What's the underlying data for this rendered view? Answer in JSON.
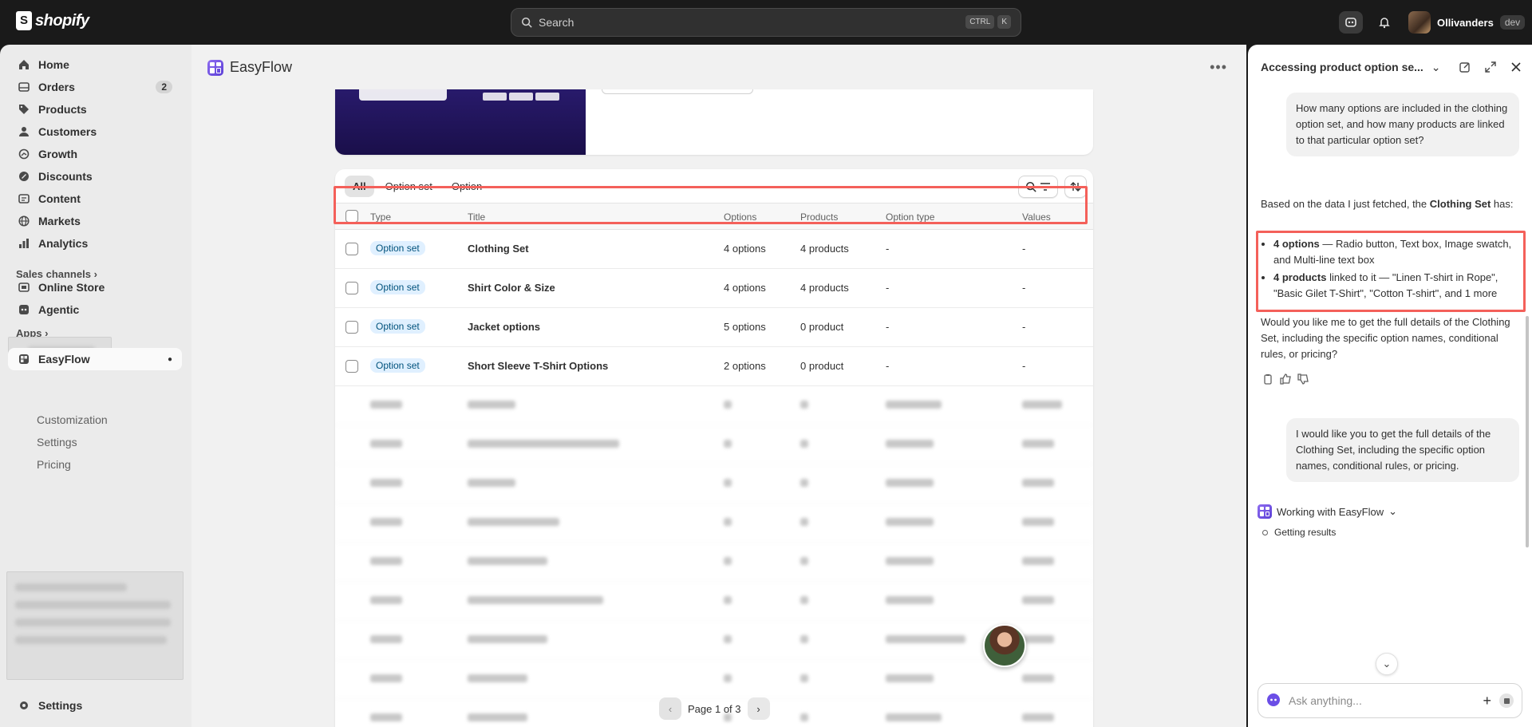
{
  "brand": {
    "name": "shopify"
  },
  "search": {
    "placeholder": "Search",
    "kbd1": "CTRL",
    "kbd2": "K"
  },
  "user": {
    "name": "Ollivanders",
    "badge": "dev"
  },
  "nav": {
    "items": [
      {
        "label": "Home",
        "icon": "home-icon"
      },
      {
        "label": "Orders",
        "icon": "orders-icon",
        "count": "2"
      },
      {
        "label": "Products",
        "icon": "tag-icon"
      },
      {
        "label": "Customers",
        "icon": "person-icon"
      },
      {
        "label": "Growth",
        "icon": "growth-icon"
      },
      {
        "label": "Discounts",
        "icon": "discount-icon"
      },
      {
        "label": "Content",
        "icon": "content-icon"
      },
      {
        "label": "Markets",
        "icon": "globe-icon"
      },
      {
        "label": "Analytics",
        "icon": "chart-icon"
      }
    ],
    "sales_channels": "Sales channels",
    "online_store": "Online Store",
    "agentic": "Agentic",
    "apps": "Apps",
    "easyflow": "EasyFlow",
    "sub": [
      "Customization",
      "Settings",
      "Pricing"
    ],
    "settings": "Settings"
  },
  "app": {
    "title": "EasyFlow"
  },
  "table": {
    "tabs": [
      "All",
      "Option set",
      "Option"
    ],
    "headers": [
      "Type",
      "Title",
      "Options",
      "Products",
      "Option type",
      "Values"
    ],
    "rows": [
      {
        "type": "Option set",
        "title": "Clothing Set",
        "options": "4 options",
        "products": "4 products",
        "option_type": "-",
        "values": "-"
      },
      {
        "type": "Option set",
        "title": "Shirt Color & Size",
        "options": "4 options",
        "products": "4 products",
        "option_type": "-",
        "values": "-"
      },
      {
        "type": "Option set",
        "title": "Jacket options",
        "options": "5 options",
        "products": "0 product",
        "option_type": "-",
        "values": "-"
      },
      {
        "type": "Option set",
        "title": "Short Sleeve T-Shirt Options",
        "options": "2 options",
        "products": "0 product",
        "option_type": "-",
        "values": "-"
      }
    ],
    "pager": "Page 1 of 3"
  },
  "chat": {
    "title": "Accessing product option se...",
    "q1": "How many options are included in the clothing option set, and how many products are linked to that particular option set?",
    "a1_intro_pre": "Based on the data I just fetched, the ",
    "a1_intro_bold": "Clothing Set",
    "a1_intro_post": " has:",
    "a1_b1_bold": "4 options",
    "a1_b1_rest": " — Radio button, Text box, Image swatch, and Multi-line text box",
    "a1_b2_bold": "4 products",
    "a1_b2_rest": " linked to it — \"Linen T-shirt in Rope\", \"Basic Gilet T-Shirt\", \"Cotton T-shirt\", and 1 more",
    "a1_follow": "Would you like me to get the full details of the Clothing Set, including the specific option names, conditional rules, or pricing?",
    "q2": "I would like you to get the full details of the Clothing Set, including the specific option names, conditional rules, or pricing.",
    "working": "Working with EasyFlow",
    "getting": "Getting results",
    "ask_placeholder": "Ask anything..."
  },
  "colors": {
    "highlight": "#f4605a",
    "badge_bg": "#e0f0ff",
    "badge_text": "#00527c",
    "accent": "#6b4ee6"
  }
}
